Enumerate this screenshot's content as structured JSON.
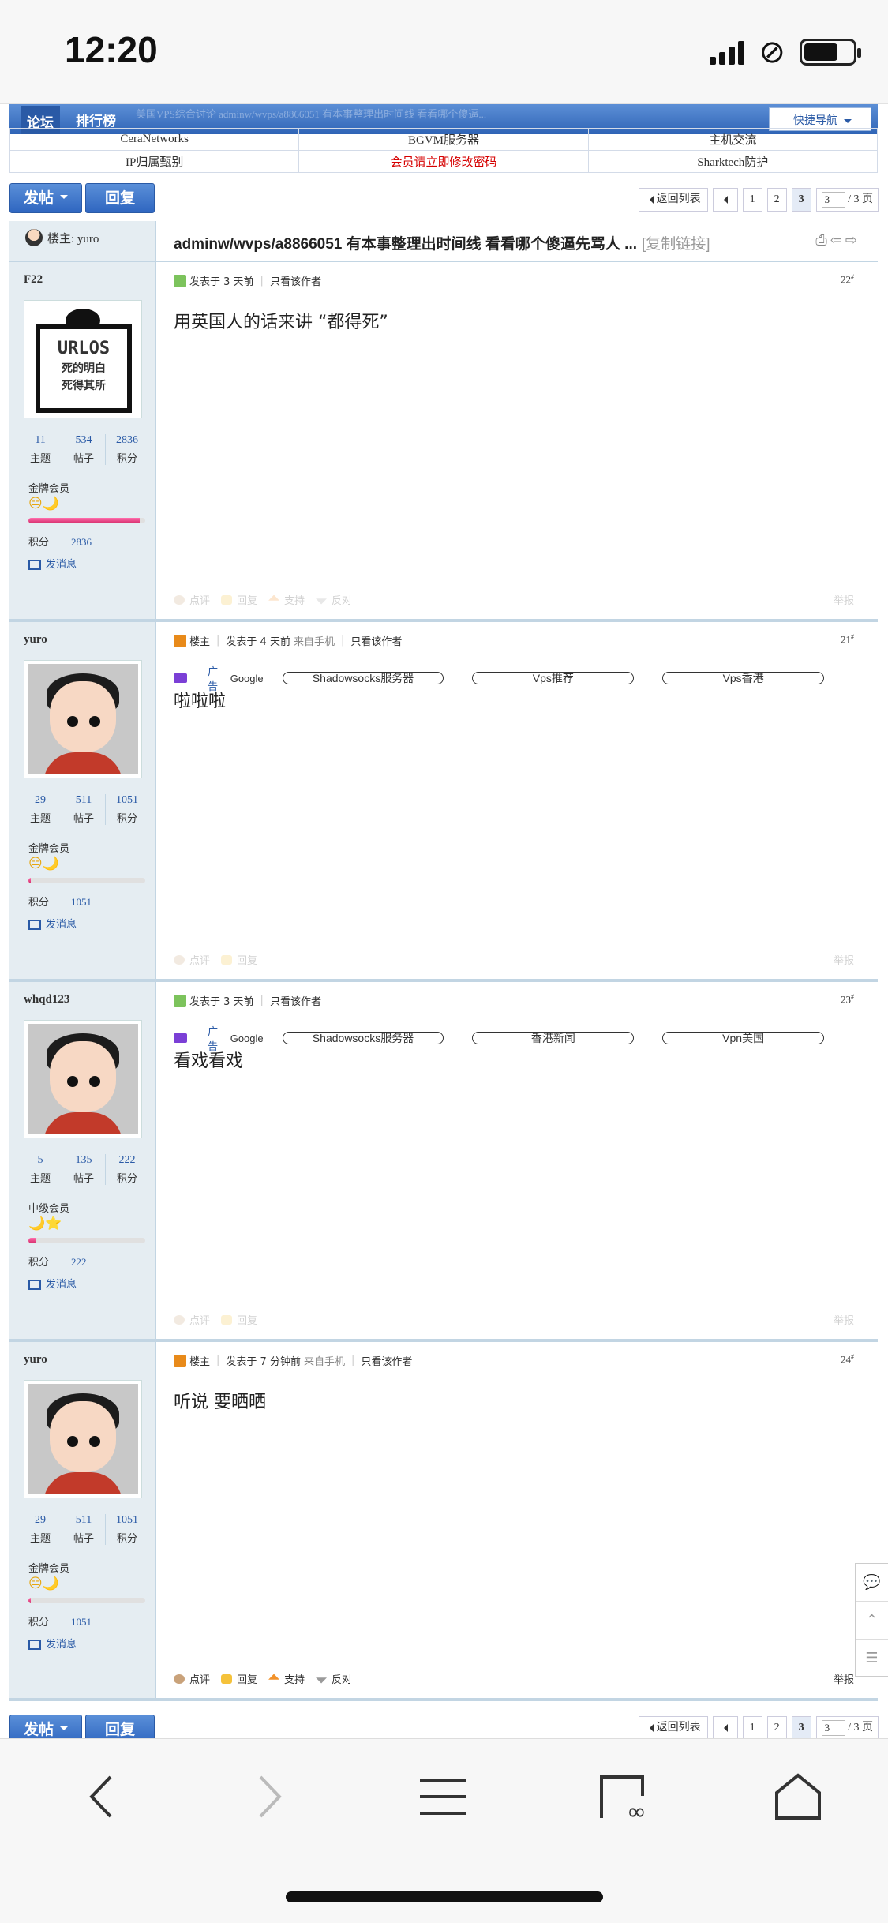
{
  "status_bar": {
    "time": "12:20"
  },
  "nav": {
    "tabs": [
      "论坛",
      "排行榜"
    ],
    "breadcrumb_ghost": "美国VPS综合讨论   adminw/wvps/a8866051 有本事整理出时间线 看看哪个傻逼...",
    "quick_nav": "快捷导航"
  },
  "links": [
    [
      "CeraNetworks",
      "BGVM服务器",
      "主机交流"
    ],
    [
      "IP归属甄别",
      "会员请立即修改密码",
      "Sharktech防护"
    ]
  ],
  "toolbar": {
    "post_label": "发帖",
    "reply_label": "回复"
  },
  "pager": {
    "back": "返回列表",
    "pages": [
      "1",
      "2",
      "3"
    ],
    "current": "3",
    "jump_value": "3",
    "total": "/ 3 页"
  },
  "thread": {
    "louzhu_label": "楼主: yuro",
    "title": "adminw/wvps/a8866051 有本事整理出时间线 看看哪个傻逼先骂人 ...",
    "copy_link": "[复制链接]"
  },
  "labels": {
    "topics": "主题",
    "posts": "帖子",
    "points": "积分",
    "score": "积分",
    "send_msg": "发消息",
    "louzhu": "楼主",
    "only_author": "只看该作者",
    "from_mobile": "来自手机",
    "rate": "点评",
    "reply": "回复",
    "support": "支持",
    "oppose": "反对",
    "report": "举报",
    "ad": "广告",
    "google": "Google"
  },
  "posts": [
    {
      "user": "F22",
      "topics": "11",
      "posts": "534",
      "points": "2836",
      "group": "金牌会员",
      "stars": "😑🌙",
      "progress": 0.95,
      "time": "发表于 3 天前",
      "is_op": false,
      "mobile": false,
      "floor": "22",
      "content": "用英国人的话来讲 “都得死”",
      "ads": []
    },
    {
      "user": "yuro",
      "topics": "29",
      "posts": "511",
      "points": "1051",
      "group": "金牌会员",
      "stars": "😑🌙",
      "progress": 0.02,
      "time": "发表于 4 天前",
      "is_op": true,
      "mobile": true,
      "floor": "21",
      "content": "啦啦啦",
      "ads": [
        "Shadowsocks服务器",
        "Vps推荐",
        "Vps香港"
      ]
    },
    {
      "user": "whqd123",
      "topics": "5",
      "posts": "135",
      "points": "222",
      "group": "中级会员",
      "stars": "🌙⭐",
      "progress": 0.07,
      "time": "发表于 3 天前",
      "is_op": false,
      "mobile": false,
      "floor": "23",
      "content": "看戏看戏",
      "ads": [
        "Shadowsocks服务器",
        "香港新闻",
        "Vpn美国"
      ]
    },
    {
      "user": "yuro",
      "topics": "29",
      "posts": "511",
      "points": "1051",
      "group": "金牌会员",
      "stars": "😑🌙",
      "progress": 0.02,
      "time": "发表于 7 分钟前",
      "is_op": true,
      "mobile": true,
      "floor": "24",
      "content": "听说 要晒晒",
      "ads": []
    }
  ],
  "floor_suffix": "#",
  "colors": {
    "nav_blue": "#2f64b6",
    "link_blue": "#2a5aa6",
    "red": "#d60000",
    "sidebar": "#e5edf2"
  }
}
